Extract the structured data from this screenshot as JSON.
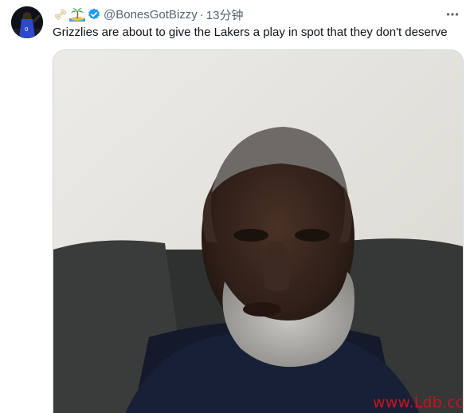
{
  "tweet": {
    "user": {
      "emoji_icons": [
        "bone-icon",
        "desert-island-icon"
      ],
      "handle": "@BonesGotBizzy",
      "verified": true,
      "avatar_icon": "avatar"
    },
    "separator": "·",
    "time": "13分钟",
    "text": "Grizzlies are about to give the Lakers a play in spot that they don't deserve",
    "more_icon": "more-options-icon",
    "media": {
      "type": "video-still",
      "icon": "man-on-couch-video-frame"
    }
  },
  "watermark": {
    "text": "www.Ldb.cc",
    "color": "#c9131f"
  },
  "colors": {
    "text": "#0f1419",
    "secondary": "#536471",
    "verified": "#1d9bf0",
    "border": "#cfd9de"
  }
}
